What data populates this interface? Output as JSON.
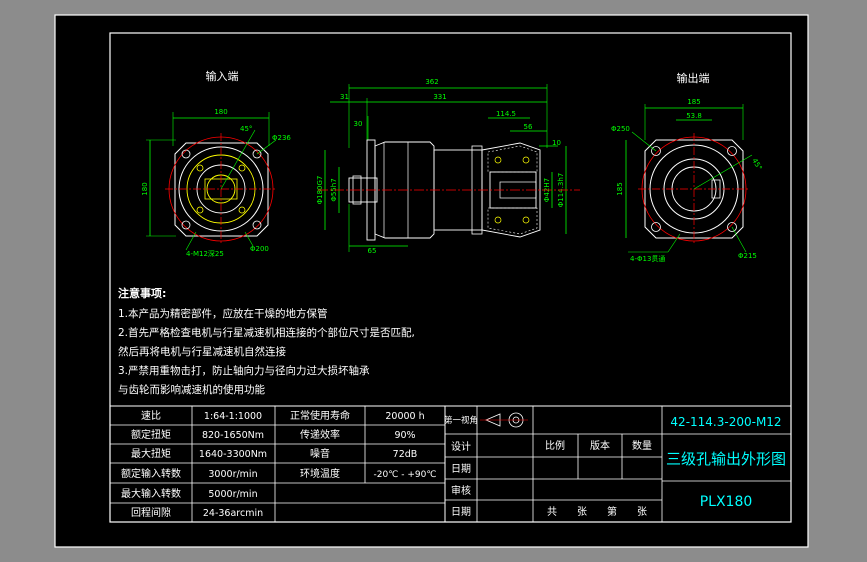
{
  "colors": {
    "background": "#8c8c8c",
    "sheet": "#000000",
    "outline": "#ffffff",
    "dimension": "#00ff00",
    "part": "#ffff00",
    "table_text": "#ffffff",
    "title_text": "#00ffff",
    "centerline": "#ff0000"
  },
  "views": {
    "input_title": "输入端",
    "output_title": "输出端"
  },
  "dims": {
    "in_width": "180",
    "in_height": "180",
    "in_angle": "45°",
    "in_bolt": "Φ236",
    "in_pcd": "Φ200",
    "in_holes": "4-M12深25",
    "side_total": "362",
    "side_body": "331",
    "side_flange": "31",
    "side_30": "30",
    "side_1145": "114.5",
    "side_56": "56",
    "side_10": "10",
    "side_65": "65",
    "side_shaft": "Φ55h7",
    "side_pilot": "Φ180G7",
    "side_bore": "Φ114.3h7",
    "side_key": "Φ42H7",
    "out_width": "185",
    "out_key": "53.8",
    "out_height": "185",
    "out_bolt": "Φ250",
    "out_angle": "45°",
    "out_pcd": "Φ215",
    "out_holes": "4-Φ13贯通"
  },
  "notes": {
    "heading": "注意事项:",
    "line1": "1.本产品为精密部件，应放在干燥的地方保管",
    "line2": "2.首先严格检查电机与行星减速机相连接的个部位尺寸是否匹配,",
    "line3": "然后再将电机与行星减速机自然连接",
    "line4": "3.严禁用重物击打，防止轴向力与径向力过大损坏轴承",
    "line5": "与齿轮而影响减速机的使用功能"
  },
  "specs": {
    "rows": [
      {
        "label": "速比",
        "value": "1:64-1:1000",
        "label2": "正常使用寿命",
        "value2": "20000 h"
      },
      {
        "label": "额定扭矩",
        "value": "820-1650Nm",
        "label2": "传递效率",
        "value2": "90%"
      },
      {
        "label": "最大扭矩",
        "value": "1640-3300Nm",
        "label2": "噪音",
        "value2": "72dB"
      },
      {
        "label": "额定输入转数",
        "value": "3000r/min",
        "label2": "环境温度",
        "value2": "-20℃ - +90℃"
      },
      {
        "label": "最大输入转数",
        "value": "5000r/min",
        "label2": "",
        "value2": ""
      },
      {
        "label": "回程间隙",
        "value": "24-36arcmin",
        "label2": "",
        "value2": ""
      }
    ]
  },
  "titleblock": {
    "projection": "第一视角",
    "design": "设计",
    "date1": "日期",
    "review": "审核",
    "date2": "日期",
    "scale": "比例",
    "version": "版本",
    "quantity": "数量",
    "sheets": "共　　张　　第　　张",
    "drawing_no": "42-114.3-200-M12",
    "drawing_title": "三级孔输出外形图",
    "model": "PLX180"
  }
}
